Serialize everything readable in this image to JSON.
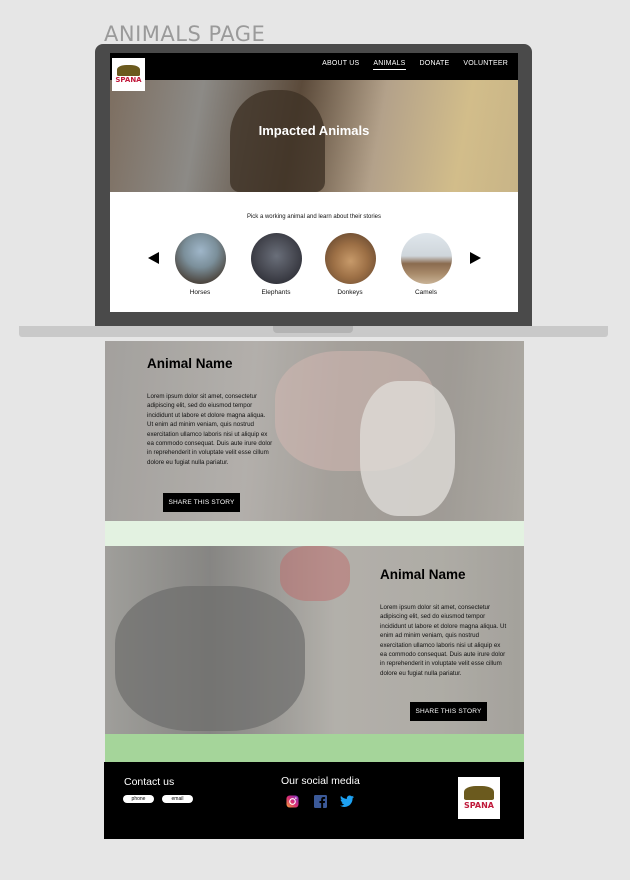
{
  "page_label": "ANIMALS PAGE",
  "nav": {
    "logo_text": "SPANA",
    "items": [
      "ABOUT US",
      "ANIMALS",
      "DONATE",
      "VOLUNTEER"
    ],
    "active": "ANIMALS"
  },
  "hero": {
    "title": "Impacted Animals"
  },
  "picker": {
    "prompt": "Pick a working animal and learn about their stories",
    "animals": [
      "Horses",
      "Elephants",
      "Donkeys",
      "Camels"
    ]
  },
  "stories": [
    {
      "title": "Animal Name",
      "body": "Lorem ipsum dolor sit amet, consectetur adipiscing elit, sed do eiusmod tempor incididunt ut labore et dolore magna aliqua. Ut enim ad minim veniam, quis nostrud exercitation ullamco laboris nisi ut aliquip ex ea commodo consequat. Duis aute irure dolor in reprehenderit in voluptate velit esse cillum dolore eu fugiat nulla pariatur.",
      "button": "SHARE THIS STORY"
    },
    {
      "title": "Animal Name",
      "body": "Lorem ipsum dolor sit amet, consectetur adipiscing elit, sed do eiusmod tempor incididunt ut labore et dolore magna aliqua. Ut enim ad minim veniam, quis nostrud exercitation ullamco laboris nisi ut aliquip ex ea commodo consequat. Duis aute irure dolor in reprehenderit in voluptate velit esse cillum dolore eu fugiat nulla pariatur.",
      "button": "SHARE THIS STORY"
    }
  ],
  "footer": {
    "contact_title": "Contact us",
    "phone_label": "phone",
    "email_label": "email",
    "social_title": "Our social media",
    "social_icons": [
      "instagram-icon",
      "facebook-icon",
      "twitter-icon"
    ],
    "logo_text": "SPANA"
  },
  "colors": {
    "nav_bg": "#000000",
    "band_light": "#e3f2e1",
    "band_green": "#a5d59a",
    "instagram": "#d62976",
    "facebook": "#3b5998",
    "twitter": "#1da1f2",
    "logo_red": "#c0183a"
  }
}
